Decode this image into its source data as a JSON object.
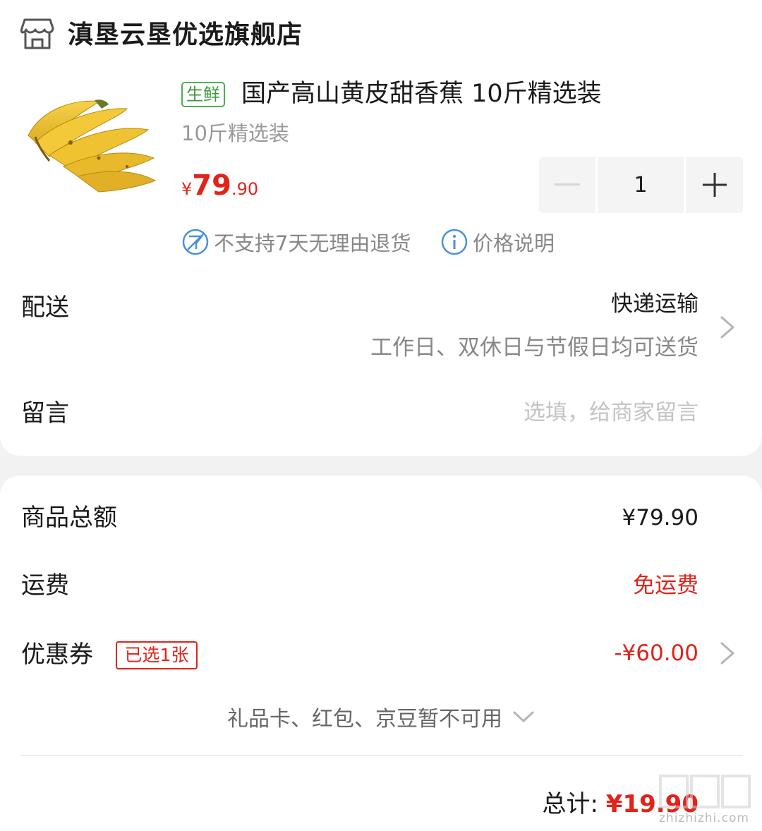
{
  "store": {
    "icon": "store-icon",
    "name": "滇垦云垦优选旗舰店"
  },
  "product": {
    "image": "banana-bunch",
    "tag": "生鲜",
    "title": "国产高山黄皮甜香蕉 10斤精选装",
    "spec": "10斤精选装",
    "price": {
      "currency": "¥",
      "integer": "79",
      "decimal": ".90"
    },
    "quantity": "1",
    "notes": {
      "return_policy": "不支持7天无理由退货",
      "price_info": "价格说明"
    }
  },
  "delivery": {
    "label": "配送",
    "method": "快递运输",
    "description": "工作日、双休日与节假日均可送货"
  },
  "message": {
    "label": "留言",
    "placeholder": "选填，给商家留言"
  },
  "summary": {
    "goods_total_label": "商品总额",
    "goods_total_value": "¥79.90",
    "shipping_label": "运费",
    "shipping_value": "免运费",
    "coupon_label": "优惠券",
    "coupon_badge": "已选1张",
    "coupon_value": "-¥60.00",
    "unavailable_text": "礼品卡、红包、京豆暂不可用",
    "total_label": "总计:",
    "total_value": "¥19.90"
  },
  "watermark": {
    "logo": "值",
    "site": "zhizhizhi.com"
  },
  "colors": {
    "price_red": "#e2231a",
    "fresh_green": "#4caf50",
    "muted_gray": "#888888",
    "info_blue": "#4a90d9"
  }
}
